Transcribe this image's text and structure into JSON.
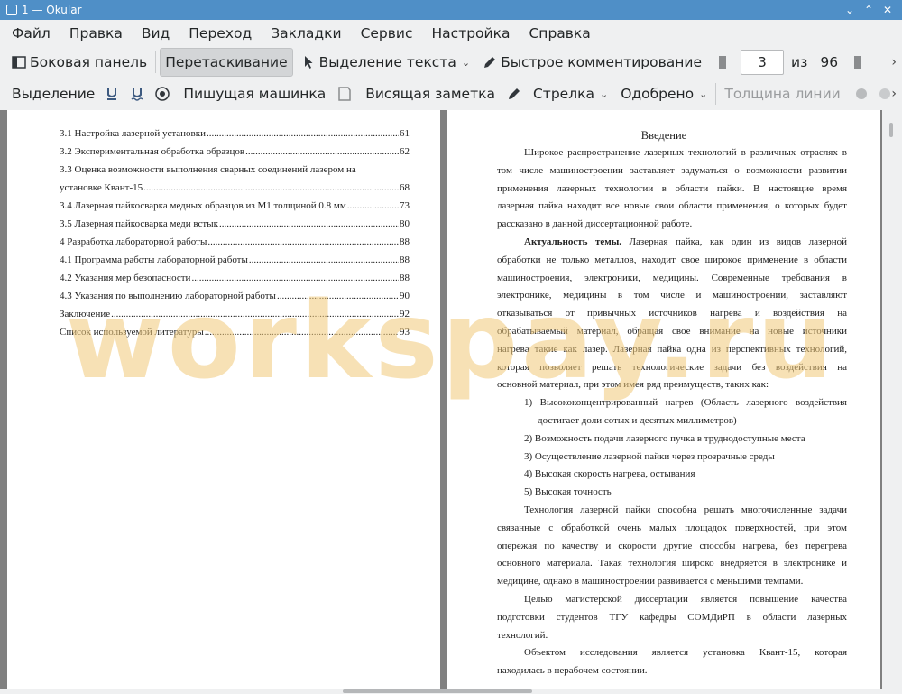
{
  "window": {
    "title": "1 — Okular"
  },
  "menu": [
    "Файл",
    "Правка",
    "Вид",
    "Переход",
    "Закладки",
    "Сервис",
    "Настройка",
    "Справка"
  ],
  "toolbar1": {
    "sidebar": "Боковая панель",
    "drag": "Перетаскивание",
    "select_text": "Выделение текста",
    "quick_comment": "Быстрое комментирование",
    "page_current": "3",
    "page_of": "из",
    "page_total": "96"
  },
  "toolbar2": {
    "selection": "Выделение",
    "typewriter": "Пишущая машинка",
    "note": "Висящая заметка",
    "arrow": "Стрелка",
    "approved": "Одобрено",
    "line_width": "Толщина линии"
  },
  "toc": [
    {
      "text": "3.1 Настройка лазерной установки",
      "page": "61"
    },
    {
      "text": "3.2 Экспериментальная обработка образцов",
      "page": "62"
    },
    {
      "text": "3.3 Оценка возможности выполнения сварных соединений лазером на",
      "page": ""
    },
    {
      "text": "установке Квант-15",
      "page": "68"
    },
    {
      "text": "3.4 Лазерная пайкосварка медных образцов из М1 толщиной 0.8 мм",
      "page": "73"
    },
    {
      "text": "3.5 Лазерная пайкосварка меди встык",
      "page": "80"
    },
    {
      "text": "4 Разработка лабораторной работы",
      "page": "88"
    },
    {
      "text": "4.1 Программа работы лабораторной работы",
      "page": "88"
    },
    {
      "text": "4.2 Указания мер безопасности",
      "page": "88"
    },
    {
      "text": "4.3 Указания по выполнению лабораторной работы",
      "page": "90"
    },
    {
      "text": "Заключение",
      "page": "92"
    },
    {
      "text": "Список используемой литературы",
      "page": "93"
    }
  ],
  "right_page": {
    "heading": "Введение",
    "lines": [
      "Широкое распространение лазерных технологий в различных отраслях в",
      "том числе машиностроении заставляет задуматься о возможности развитии",
      "применения лазерных технологии в области пайки. В настоящие время",
      "лазерная пайка находит все новые свои области применения, о которых будет",
      "рассказано в данной диссертационной работе.",
      "Актуальность темы. Лазерная пайка, как один из видов лазерной",
      "обработки не только металлов, находит свое широкое применение в области",
      "машиностроения, электроники, медицины. Современные требования в",
      "электронике, медицины в том числе и машиностроении, заставляют",
      "отказываться от привычных источников нагрева и воздействия на",
      "обрабатываемый материал, обращая свое внимание на новые источники",
      "нагрева такие как лазер. Лазерная пайка одна из перспективных технологий,",
      "которая позволяет решать технологические задачи без воздействия на",
      "основной материал, при этом имея ряд преимуществ, таких как:",
      "1) Высококонцентрированный нагрев (Область лазерного воздействия",
      "достигает доли сотых и десятых миллиметров)",
      "2) Возможность подачи лазерного пучка в труднодоступные места",
      "3) Осуществление лазерной пайки через прозрачные среды",
      "4) Высокая скорость нагрева, остывания",
      "5) Высокая точность",
      "Технология лазерной пайки способна решать многочисленные задачи",
      "связанные с обработкой очень малых площадок поверхностей, при этом",
      "опережая по качеству и скорости другие способы нагрева, без перегрева",
      "основного материала. Такая технология широко внедряется в электронике и",
      "медицине, однако в машиностроении развивается с меньшими темпами.",
      "Целью магистерской диссертации является повышение качества",
      "подготовки студентов ТГУ кафедры СОМДиРП в области лазерных",
      "технологий.",
      "Объектом исследования является установка Квант-15, которая",
      "находилась в нерабочем состоянии."
    ]
  },
  "watermark": "workspay.ru",
  "colors": {
    "titlebar": "#4f8fc7",
    "background": "#eff0f1",
    "viewport": "#808080"
  }
}
